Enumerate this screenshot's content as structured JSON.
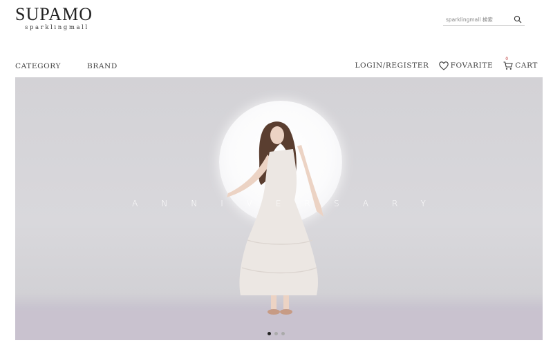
{
  "logo": {
    "main": "SUPAMO",
    "sub": "sparklingmall"
  },
  "search": {
    "placeholder": "sparklingmall 検索"
  },
  "nav": {
    "left": [
      {
        "label": "CATEGORY"
      },
      {
        "label": "BRAND"
      }
    ],
    "login": "LOGIN/REGISTER",
    "favorite": "FOVARITE",
    "cart": "CART",
    "cart_count": "0"
  },
  "hero": {
    "title": "ANNIVERSARY",
    "slide_count": 3,
    "active_slide": 1
  }
}
